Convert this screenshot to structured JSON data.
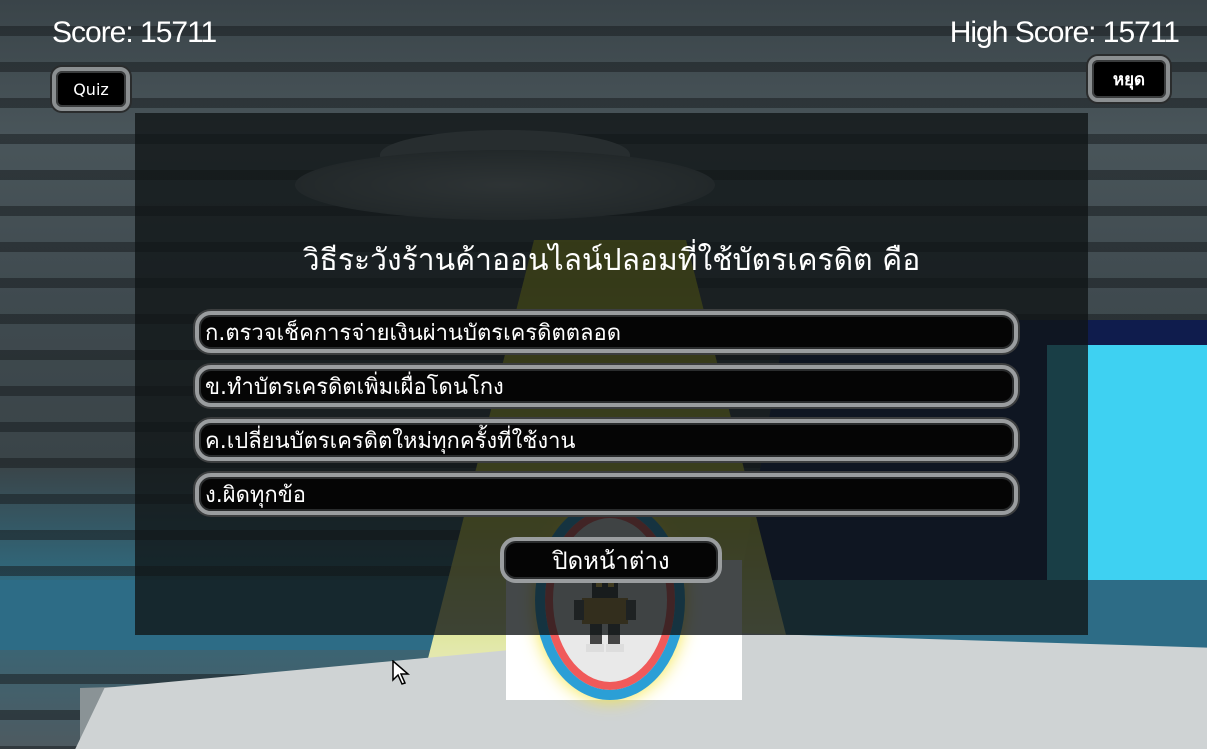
{
  "hud": {
    "score_text": "Score: 15711",
    "high_score_text": "High Score: 15711",
    "quiz_button_label": "Quiz",
    "stop_button_label": "หยุด"
  },
  "quiz": {
    "question": "วิธีระวังร้านค้าออนไลน์ปลอมที่ใช้บัตรเครดิต คือ",
    "answers": [
      "ก.ตรวจเช็คการจ่ายเงินผ่านบัตรเครดิตตลอด",
      "ข.ทำบัตรเครดิตเพิ่มเผื่อโดนโกง",
      "ค.เปลี่ยนบัตรเครดิตใหม่ทุกครั้งที่ใช้งาน",
      "ง.ผิดทุกข้อ"
    ],
    "close_button_label": "ปิดหน้าต่าง"
  },
  "colors": {
    "panel_overlay": "#101416",
    "button_face": "#050505",
    "button_frame": "#9a9d9f",
    "text": "#ffffff"
  }
}
